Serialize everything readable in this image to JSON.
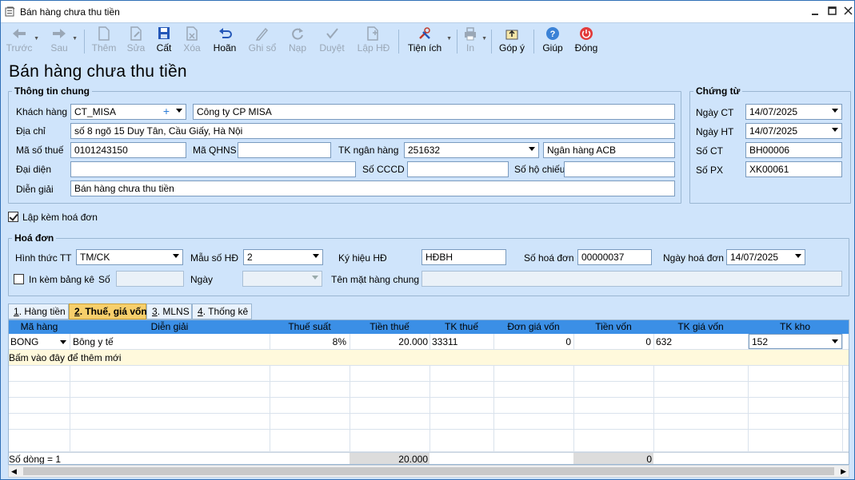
{
  "window": {
    "title": "Bán hàng chưa thu tiền"
  },
  "toolbar": {
    "prev": "Trước",
    "next": "Sau",
    "add": "Thêm",
    "edit": "Sửa",
    "save": "Cất",
    "delete": "Xóa",
    "undo": "Hoãn",
    "post": "Ghi sổ",
    "reload": "Nạp",
    "approve": "Duyệt",
    "create_invoice": "Lập HĐ",
    "utilities": "Tiện ích",
    "print": "In",
    "feedback": "Góp ý",
    "help": "Giúp",
    "close": "Đóng"
  },
  "page_title": "Bán hàng chưa thu tiền",
  "general": {
    "legend": "Thông tin chung",
    "customer_label": "Khách hàng",
    "customer_code": "CT_MISA",
    "customer_name": "Công ty CP MISA",
    "address_label": "Địa chỉ",
    "address": "số 8 ngõ 15 Duy Tân, Cầu Giấy, Hà Nội",
    "tax_code_label": "Mã số thuế",
    "tax_code": "0101243150",
    "qhns_label": "Mã QHNS",
    "qhns": "",
    "bank_account_label": "TK ngân hàng",
    "bank_account": "251632",
    "bank_name": "Ngân hàng ACB",
    "representative_label": "Đại diện",
    "representative": "",
    "cccd_label": "Số CCCD",
    "cccd": "",
    "passport_label": "Số hộ chiếu",
    "passport": "",
    "description_label": "Diễn giải",
    "description": "Bán hàng chưa thu tiền"
  },
  "voucher": {
    "legend": "Chứng từ",
    "date_ct_label": "Ngày CT",
    "date_ct": "14/07/2025",
    "date_ht_label": "Ngày HT",
    "date_ht": "14/07/2025",
    "so_ct_label": "Số CT",
    "so_ct": "BH00006",
    "so_px_label": "Số PX",
    "so_px": "XK00061"
  },
  "with_invoice": {
    "label": "Lập kèm hoá đơn",
    "checked": true
  },
  "invoice": {
    "legend": "Hoá đơn",
    "payment_label": "Hình thức TT",
    "payment": "TM/CK",
    "template_label": "Mẫu số HĐ",
    "template": "2",
    "symbol_label": "Ký hiệu HĐ",
    "symbol": "HĐBH",
    "number_label": "Số hoá đơn",
    "number": "00000037",
    "date_label": "Ngày hoá đơn",
    "date": "14/07/2025",
    "print_list_label": "In kèm bảng kê",
    "so_label": "Số",
    "so": "",
    "ngay_label": "Ngày",
    "ngay": "",
    "common_name_label": "Tên mặt hàng chung",
    "common_name": ""
  },
  "tabs": [
    {
      "num": "1",
      "label": ". Hàng tiền"
    },
    {
      "num": "2",
      "label": ". Thuế, giá vốn"
    },
    {
      "num": "3",
      "label": ". MLNS"
    },
    {
      "num": "4",
      "label": ". Thống kê"
    }
  ],
  "grid": {
    "columns": [
      "Mã hàng",
      "Diễn giải",
      "Thuế suất",
      "Tiền thuế",
      "TK thuế",
      "Đơn giá vốn",
      "Tiền vốn",
      "TK giá vốn",
      "TK kho"
    ],
    "rows": [
      {
        "ma_hang": "BONG",
        "dien_giai": "Bông y tế",
        "thue_suat": "8%",
        "tien_thue": "20.000",
        "tk_thue": "33311",
        "don_gia_von": "0",
        "tien_von": "0",
        "tk_gia_von": "632",
        "tk_kho": "152"
      }
    ],
    "add_hint": "Bấm vào đây để thêm mới",
    "footer": {
      "row_count": "Số dòng = 1",
      "total_tax": "20.000",
      "total_cost": "0"
    }
  }
}
